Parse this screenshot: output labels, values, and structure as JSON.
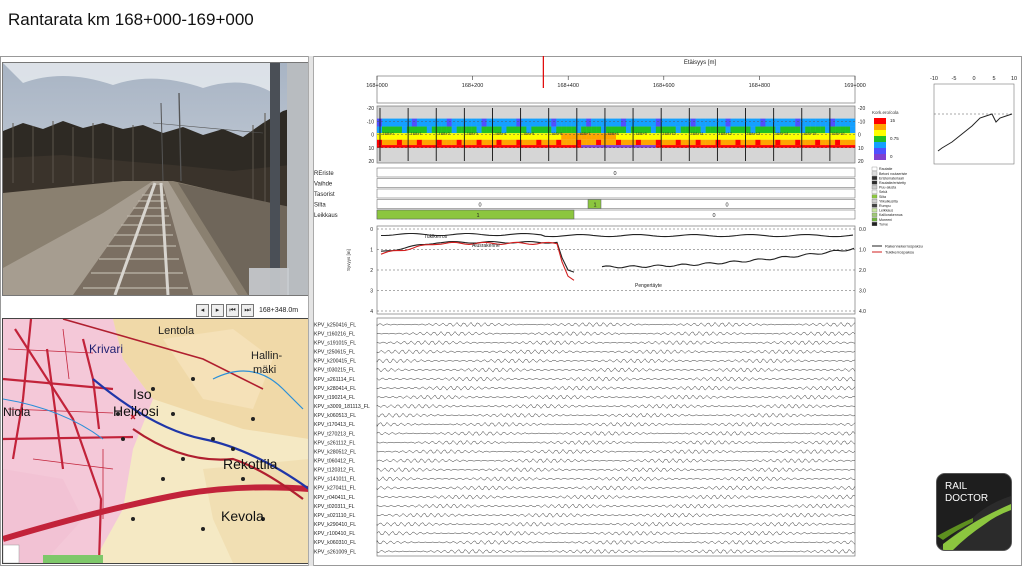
{
  "title": "Rantarata km 168+000-169+000",
  "photo": {
    "position_label": "168+348.0m",
    "controls": [
      "◂",
      "▸",
      "⏮",
      "⏭"
    ]
  },
  "map": {
    "places": [
      "Lentola",
      "Krivari",
      "Hallin-",
      "mäki",
      "Iso",
      "Heikosi",
      "Rekottila",
      "Kevola",
      "Niola"
    ]
  },
  "distance_axis": {
    "label": "Etäisyys [m]",
    "ticks": [
      "168+000",
      "168+200",
      "168+400",
      "168+600",
      "168+800",
      "169+000"
    ],
    "tick_values": [
      168000,
      168200,
      168400,
      168600,
      168800,
      169000
    ],
    "current_position": 168348
  },
  "gpr": {
    "y_ticks": [
      "-20",
      "-10",
      "0",
      "10",
      "20"
    ],
    "y_tick_values": [
      -20,
      -10,
      0,
      10,
      20
    ],
    "section_labels": [
      "168+0",
      "168+1",
      "168+2",
      "168+3",
      "168+4",
      "168+5",
      "168+6",
      "168+7",
      "168+8",
      "168+9",
      "168+10",
      "168+11",
      "168+12",
      "168+13",
      "168+14",
      "168+15",
      "168+16"
    ],
    "colorbar_title": "Kork.ero/cola",
    "colorbar_ticks": [
      "15",
      "0.75",
      "0"
    ],
    "colors": [
      "#ff0000",
      "#ffa500",
      "#ffff00",
      "#22c022",
      "#14a0ff",
      "#5050ff",
      "#8040d0"
    ]
  },
  "tracks": {
    "rows": [
      {
        "label": "REriste",
        "value_labels": [
          "0"
        ]
      },
      {
        "label": "Vaihde",
        "value_labels": []
      },
      {
        "label": "Tasorist",
        "value_labels": []
      },
      {
        "label": "Silta",
        "value_labels": [
          "0",
          "1",
          "0"
        ]
      },
      {
        "label": "Leikkaus",
        "value_labels": [
          "1",
          "0"
        ]
      }
    ],
    "legend": [
      "Rautatie",
      "Betoni routaeriste",
      "Eristemateriaali",
      "Rautatie/eristetty",
      "Puu-alusta",
      "Sekä",
      "Silta",
      "Ylikulkusilta",
      "Rumpu",
      "Leikkaus",
      "Kalliorakennus",
      "Moreeni",
      "Turve"
    ]
  },
  "profile": {
    "y_label": "Syvyys [m]",
    "left_ticks": [
      "0",
      "1",
      "2",
      "3",
      "4"
    ],
    "right_ticks": [
      "0.0",
      "1.0",
      "2.0",
      "3.0",
      "4.0"
    ],
    "annotations": [
      "Tukikerros",
      "Alusrakenne",
      "Pengertäyte"
    ],
    "legend": [
      "Rakennekerrospaksu",
      "Tukikerrospaksu"
    ]
  },
  "traces": {
    "labels": [
      "KPV_k250416_FL",
      "KPV_t160216_FL",
      "KPV_s191015_FL",
      "KPV_t250615_FL",
      "KPV_k200415_FL",
      "KPV_t030215_FL",
      "KPV_s261114_FL",
      "KPV_k280414_FL",
      "KPV_t190214_FL",
      "KPV_s3009_181113_FL",
      "KPV_k060513_FL",
      "KPV_t170413_FL",
      "KPV_t270213_FL",
      "KPV_s261112_FL",
      "KPV_k280512_FL",
      "KPV_t060412_FL",
      "KPV_t120312_FL",
      "KPV_s141011_FL",
      "KPV_k270411_FL",
      "KPV_r040411_FL",
      "KPV_t020311_FL",
      "KPV_s021110_FL",
      "KPV_k290410_FL",
      "KPV_r100410_FL",
      "KPV_k060310_FL",
      "KPV_s261009_FL"
    ]
  },
  "mini_chart": {
    "x_ticks": [
      "-10",
      "-5",
      "0",
      "5",
      "10"
    ],
    "x_tick_values": [
      -10,
      -5,
      0,
      5,
      10
    ]
  },
  "logo": {
    "line1": "RAIL",
    "line2": "DOCTOR"
  }
}
